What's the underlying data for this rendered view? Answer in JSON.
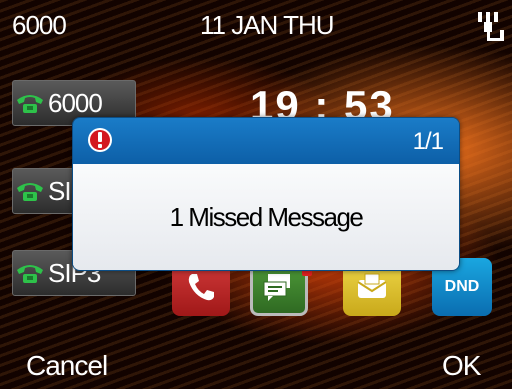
{
  "status_bar": {
    "account": "6000",
    "date": "11 JAN THU",
    "network_icon": "network-ethernet-icon"
  },
  "line_keys": [
    {
      "label": "6000",
      "icon": "phone-handset-icon",
      "color": "#2ec24a"
    },
    {
      "label": "SI",
      "icon": "phone-handset-icon",
      "color": "#2ec24a"
    },
    {
      "label": "SIP3",
      "icon": "phone-handset-icon",
      "color": "#2ec24a"
    }
  ],
  "clock": "19 : 53",
  "apps": [
    {
      "name": "phone",
      "icon": "phone-icon"
    },
    {
      "name": "messages",
      "icon": "message-icon"
    },
    {
      "name": "voicemail",
      "icon": "voicemail-icon"
    },
    {
      "name": "dnd",
      "label": "DND"
    }
  ],
  "dialog": {
    "counter": "1/1",
    "message": "1 Missed Message",
    "icon": "alert-icon"
  },
  "softkeys": {
    "left": "Cancel",
    "right": "OK"
  }
}
